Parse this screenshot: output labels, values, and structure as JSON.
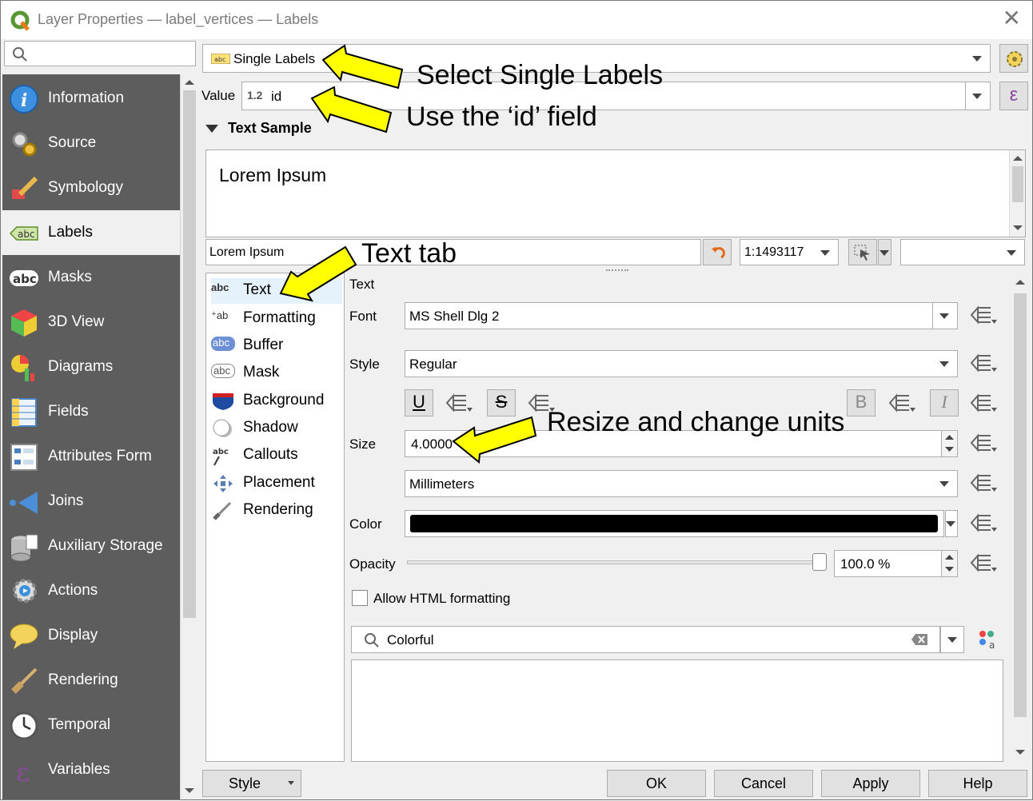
{
  "window": {
    "title": "Layer Properties — label_vertices — Labels"
  },
  "search": {
    "placeholder": ""
  },
  "sidebar": {
    "items": [
      {
        "label": "Information"
      },
      {
        "label": "Source"
      },
      {
        "label": "Symbology"
      },
      {
        "label": "Labels"
      },
      {
        "label": "Masks"
      },
      {
        "label": "3D View"
      },
      {
        "label": "Diagrams"
      },
      {
        "label": "Fields"
      },
      {
        "label": "Attributes Form"
      },
      {
        "label": "Joins"
      },
      {
        "label": "Auxiliary Storage"
      },
      {
        "label": "Actions"
      },
      {
        "label": "Display"
      },
      {
        "label": "Rendering"
      },
      {
        "label": "Temporal"
      },
      {
        "label": "Variables"
      }
    ],
    "active": "Labels"
  },
  "mode": {
    "value": "Single Labels"
  },
  "value_field": {
    "label": "Value",
    "type_badge": "1.2",
    "value": "id",
    "expr_symbol": "ε"
  },
  "text_sample": {
    "header": "Text Sample",
    "preview_text": "Lorem Ipsum",
    "input_value": "Lorem Ipsum",
    "scale": "1:1493117"
  },
  "tabs": {
    "items": [
      {
        "label": "Text",
        "icon": "abc"
      },
      {
        "label": "Formatting",
        "icon": "+ab c"
      },
      {
        "label": "Buffer",
        "icon": "abc"
      },
      {
        "label": "Mask",
        "icon": "abc"
      },
      {
        "label": "Background",
        "icon": "shield"
      },
      {
        "label": "Shadow",
        "icon": "shadow"
      },
      {
        "label": "Callouts",
        "icon": "abc"
      },
      {
        "label": "Placement",
        "icon": "move"
      },
      {
        "label": "Rendering",
        "icon": "brush"
      }
    ],
    "active": "Text"
  },
  "text_settings": {
    "section": "Text",
    "font_label": "Font",
    "font_value": "MS Shell Dlg 2",
    "style_label": "Style",
    "style_value": "Regular",
    "underline": "U",
    "strike": "S",
    "bold": "B",
    "italic": "I",
    "size_label": "Size",
    "size_value": "4.0000",
    "units_value": "Millimeters",
    "color_label": "Color",
    "color_value": "#000000",
    "opacity_label": "Opacity",
    "opacity_value": "100.0 %",
    "opacity_fraction": 1.0,
    "html_label": "Allow HTML formatting",
    "html_checked": false,
    "style_search_value": "Colorful"
  },
  "buttons": {
    "style": "Style",
    "ok": "OK",
    "cancel": "Cancel",
    "apply": "Apply",
    "help": "Help"
  },
  "annotations": {
    "a1": "Select Single Labels",
    "a2": "Use the ‘id’ field",
    "a3": "Text tab",
    "a4": "Resize and change units"
  },
  "colors": {
    "sidebar_bg": "#5d5d5d",
    "arrow_fill": "#ffff00",
    "icon_blue": "#2d7fd3"
  }
}
